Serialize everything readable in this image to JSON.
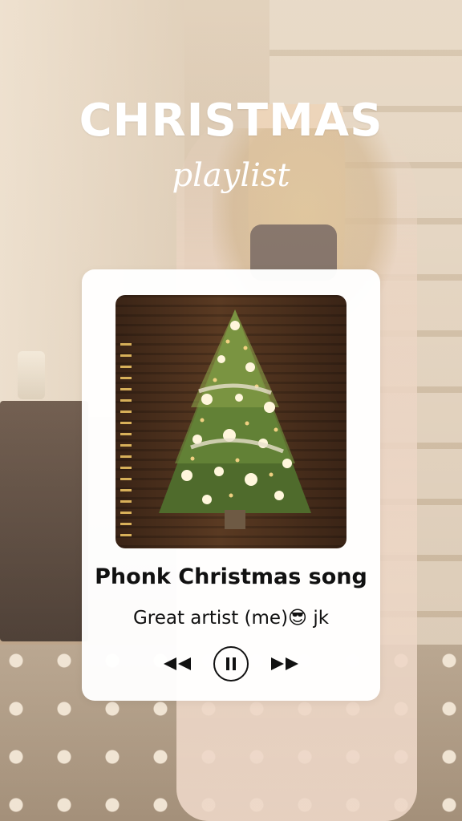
{
  "header": {
    "title": "CHRISTMAS",
    "subtitle": "playlist"
  },
  "player": {
    "song_title": "Phonk Christmas song",
    "artist": "Great artist (me)😎 jk",
    "controls": {
      "previous_icon": "rewind-icon",
      "play_pause_icon": "pause-icon",
      "next_icon": "fast-forward-icon"
    }
  },
  "colors": {
    "card_background": "#ffffff",
    "text_primary": "#111111",
    "header_text": "#ffffff"
  }
}
